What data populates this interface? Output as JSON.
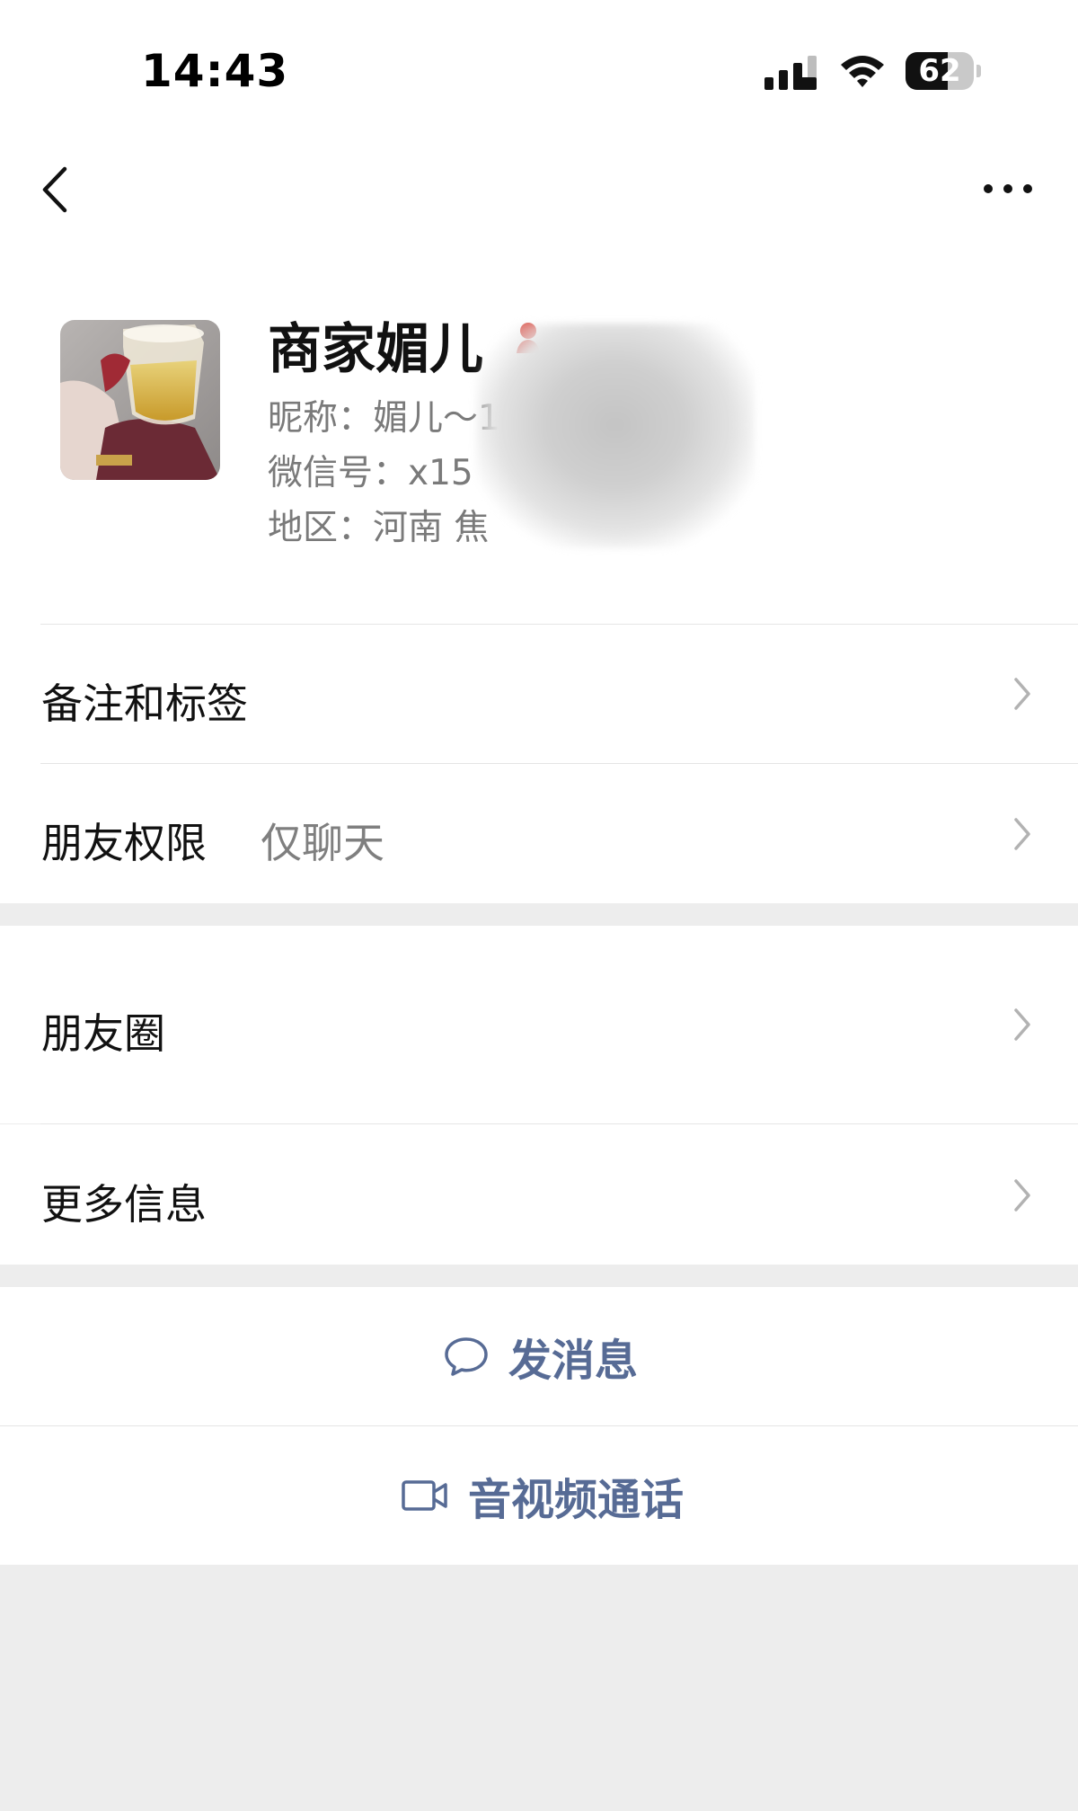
{
  "status_bar": {
    "time": "14:43",
    "battery": "62",
    "battery_level": 0.62
  },
  "nav": {
    "back_icon": "chevron-left-icon",
    "more_icon": "more-dots-icon"
  },
  "profile": {
    "name": "商家媚儿",
    "nickname_line": "昵称：媚儿～15",
    "wechat_id_line": "微信号：x15",
    "region_line": "地区：河南 焦"
  },
  "menu": {
    "remark_tags": {
      "label": "备注和标签"
    },
    "friend_permissions": {
      "label": "朋友权限",
      "value": "仅聊天"
    },
    "moments": {
      "label": "朋友圈"
    },
    "more_info": {
      "label": "更多信息"
    }
  },
  "actions": {
    "send_message": {
      "label": "发消息",
      "icon": "chat-bubble-icon"
    },
    "video_call": {
      "label": "音视频通话",
      "icon": "video-camera-icon"
    }
  },
  "colors": {
    "link_blue": "#576b95",
    "background": "#ededed"
  }
}
